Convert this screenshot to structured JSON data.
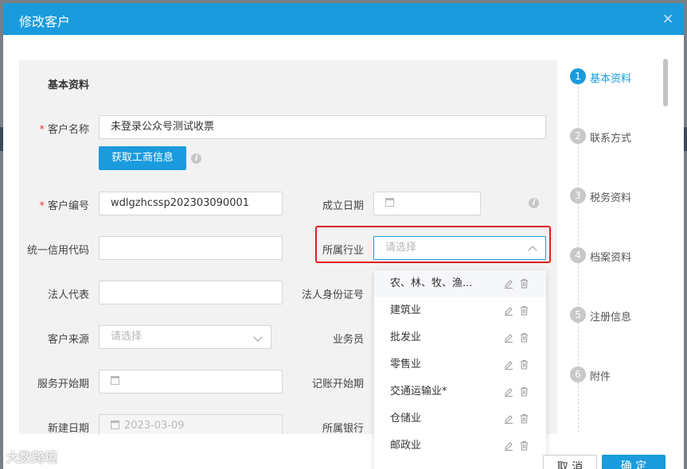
{
  "modal": {
    "title": "修改客户",
    "close_label": "×"
  },
  "form": {
    "section_title": "基本资料",
    "customer_name": {
      "label": "客户名称",
      "value": "未登录公众号测试收票"
    },
    "fetch_button": "获取工商信息",
    "customer_code": {
      "label": "客户编号",
      "value": "wdlgzhcssp202303090001"
    },
    "established_date": {
      "label": "成立日期",
      "value": ""
    },
    "credit_code": {
      "label": "统一信用代码",
      "value": ""
    },
    "industry": {
      "label": "所属行业",
      "placeholder": "请选择"
    },
    "legal_rep": {
      "label": "法人代表",
      "value": ""
    },
    "legal_id": {
      "label": "法人身份证号",
      "value": ""
    },
    "source": {
      "label": "客户来源",
      "placeholder": "请选择"
    },
    "salesperson": {
      "label": "业务员"
    },
    "service_start": {
      "label": "服务开始期",
      "value": ""
    },
    "accounting_start": {
      "label": "记账开始期"
    },
    "created_date": {
      "label": "新建日期",
      "value": "2023-03-09"
    },
    "bank": {
      "label": "所属银行"
    }
  },
  "industry_options": [
    {
      "label": "农、林、牧、渔..."
    },
    {
      "label": "建筑业"
    },
    {
      "label": "批发业"
    },
    {
      "label": "零售业"
    },
    {
      "label": "交通运输业*"
    },
    {
      "label": "仓储业"
    },
    {
      "label": "邮政业"
    }
  ],
  "steps": [
    {
      "num": "1",
      "label": "基本资料"
    },
    {
      "num": "2",
      "label": "联系方式"
    },
    {
      "num": "3",
      "label": "税务资料"
    },
    {
      "num": "4",
      "label": "档案资料"
    },
    {
      "num": "5",
      "label": "注册信息"
    },
    {
      "num": "6",
      "label": "附件"
    }
  ],
  "footer": {
    "cancel": "取 消",
    "ok": "确 定"
  },
  "watermark": "大数跨境",
  "colors": {
    "primary": "#1a9bdd",
    "highlight": "#e02020"
  }
}
